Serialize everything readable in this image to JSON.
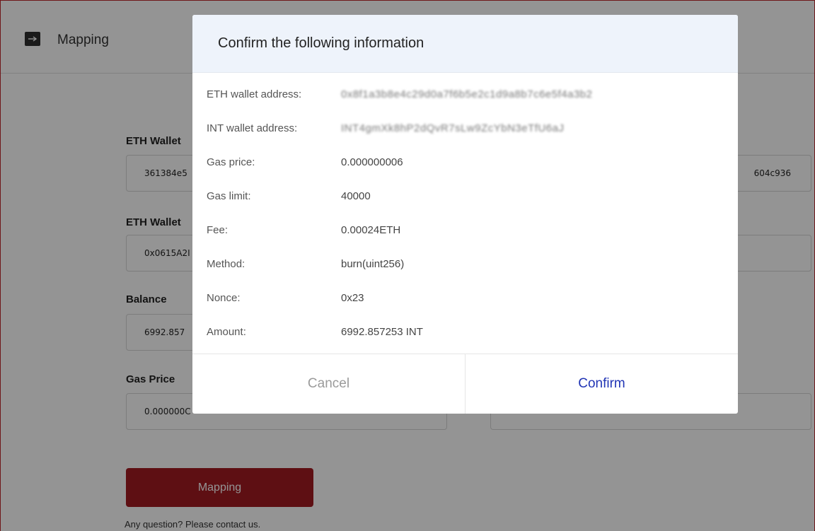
{
  "header": {
    "title": "Mapping",
    "logo_icon": "arrow-right-icon"
  },
  "form": {
    "eth_wallet_label_1": "ETH Wallet",
    "eth_wallet_value_1_left": "361384e5",
    "eth_wallet_value_1_right": "604c936",
    "eth_wallet_label_2": "ETH Wallet",
    "eth_wallet_value_2_left": "0x0615A2I",
    "balance_label": "Balance",
    "balance_value": "6992.857",
    "gas_price_label": "Gas Price",
    "gas_price_value": "0.000000C",
    "mapping_button": "Mapping",
    "help_text": "Any question? Please contact us."
  },
  "modal": {
    "title": "Confirm the following information",
    "rows": [
      {
        "label": "ETH wallet address:",
        "value": "0x8f1a3b8e4c29d0a7f6b5e2c1d9a8b7c6e5f4a3b2"
      },
      {
        "label": "INT wallet address:",
        "value": "INT4gmXk8hP2dQvR7sLw9ZcYbN3eTfU6aJ"
      },
      {
        "label": "Gas price:",
        "value": "0.000000006"
      },
      {
        "label": "Gas limit:",
        "value": "40000"
      },
      {
        "label": "Fee:",
        "value": "0.00024ETH"
      },
      {
        "label": "Method:",
        "value": "burn(uint256)"
      },
      {
        "label": "Nonce:",
        "value": "0x23"
      },
      {
        "label": "Amount:",
        "value": "6992.857253 INT"
      }
    ],
    "cancel_label": "Cancel",
    "confirm_label": "Confirm"
  },
  "colors": {
    "brand_red": "#a31a22",
    "confirm_blue": "#2135b5"
  }
}
